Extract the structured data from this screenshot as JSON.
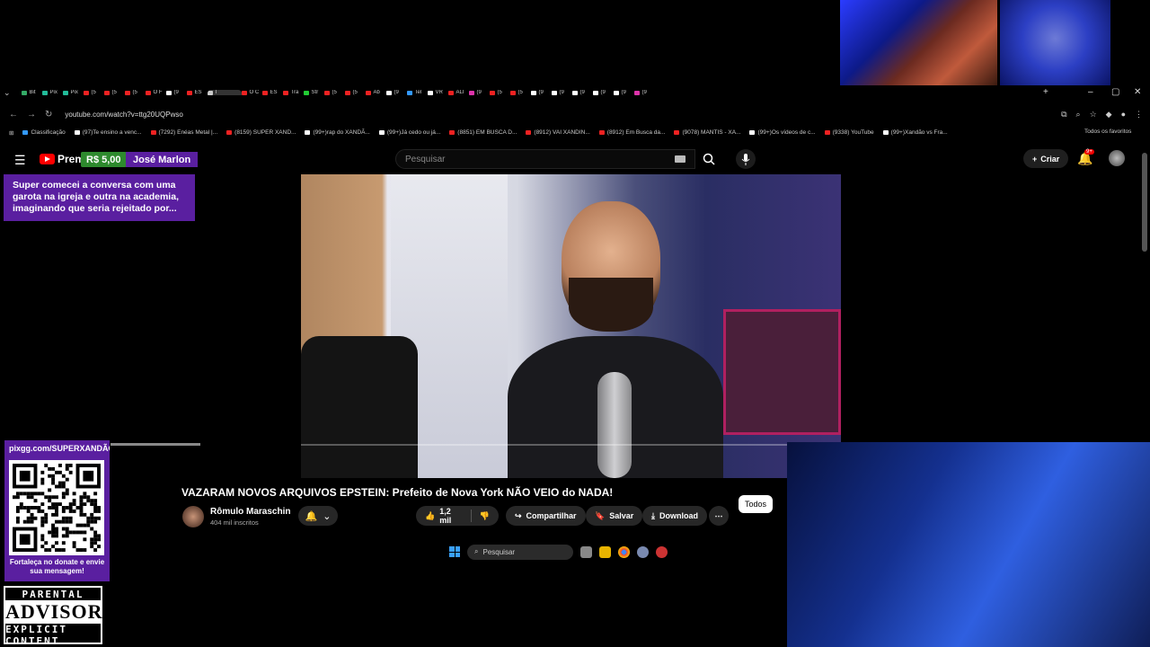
{
  "browser": {
    "url": "youtube.com/watch?v=ttg20UQPwso",
    "tabs": [
      "Bit",
      "Pix",
      "Pix",
      "(5",
      "(5",
      "(5",
      "O F",
      "(9",
      "ES",
      "I",
      "O C",
      "ES",
      "Tra",
      "Str",
      "(5",
      "(5",
      "Ab",
      "(9",
      "Tel",
      "VR",
      "ALI",
      "(9",
      "(5",
      "(5",
      "(9",
      "(9",
      "(9",
      "(9",
      "(9",
      "(9"
    ],
    "bookmarks": [
      "Classificação",
      "(97)Te ensino a venc...",
      "(7292) Enéas Metal |...",
      "(8159) SUPER XAND...",
      "(99+)rap do XANDÃ...",
      "(99+)Já cedo ou já...",
      "(8851) EM BUSCA D...",
      "(8912) VAI XANDIN...",
      "(8912) Em Busca da...",
      "(9078) MANTIS - XA...",
      "(99+)Os vídeos de c...",
      "(9338) YouTube",
      "(99+)Xandão vs Fra..."
    ],
    "all_favorites": "Todos os favoritos"
  },
  "youtube": {
    "logo_text": "Premium",
    "donation_amount": "R$ 5,00",
    "donor_name": "José Marlon",
    "search_placeholder": "Pesquisar",
    "create_label": "Criar",
    "notif_badge": "9+",
    "donation_message": "Super comecei a conversa com uma garota na igreja e outra na academia, imaginando que seria rejeitado por...",
    "video_title": "VAZARAM NOVOS ARQUIVOS EPSTEIN: Prefeito de Nova York NÃO VEIO do NADA!",
    "channel_name": "Rômulo Maraschin",
    "subscribers": "404 mil inscritos",
    "likes": "1,2 mil",
    "share_label": "Compartilhar",
    "save_label": "Salvar",
    "download_label": "Download",
    "filter_chip": "Todos"
  },
  "taskbar": {
    "search_label": "Pesquisar"
  },
  "overlay": {
    "pix_link": "pixgg.com/SUPERXANDÃO",
    "qr_caption": "Fortaleça no donate e envie sua mensagem!",
    "advisory_line1": "PARENTAL",
    "advisory_line2": "ADVISORY",
    "advisory_line3": "EXPLICIT CONTENT"
  }
}
